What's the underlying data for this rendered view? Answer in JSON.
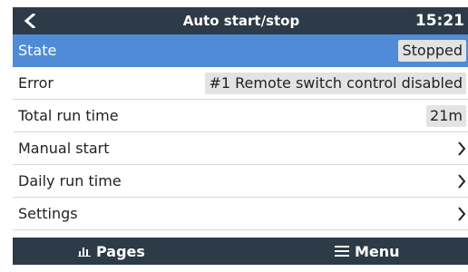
{
  "header": {
    "title": "Auto start/stop",
    "time": "15:21"
  },
  "rows": [
    {
      "label": "State",
      "value": "Stopped",
      "selected": true
    },
    {
      "label": "Error",
      "value": "#1 Remote switch control disabled"
    },
    {
      "label": "Total run time",
      "value": "21m"
    },
    {
      "label": "Manual start",
      "chevron": true
    },
    {
      "label": "Daily run time",
      "chevron": true
    },
    {
      "label": "Settings",
      "chevron": true
    }
  ],
  "footer": {
    "pages_label": "Pages",
    "menu_label": "Menu"
  },
  "colors": {
    "header_bg": "#2d3a47",
    "selected_row": "#4f8bd6",
    "value_bg": "#e3e3e3"
  },
  "icons": {
    "back": "chevron-left-icon",
    "pages": "bar-chart-icon",
    "menu": "hamburger-icon",
    "row_nav": "chevron-right-icon"
  }
}
